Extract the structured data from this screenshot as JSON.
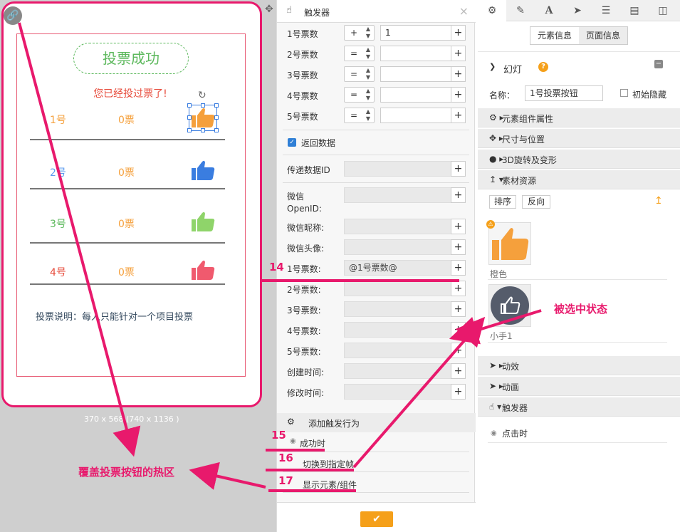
{
  "preview": {
    "vote_success": "投票成功",
    "already_voted": "您已经投过票了!",
    "rows": [
      {
        "label": "1号",
        "votes": "0票",
        "label_color": "#f5a03c",
        "thumb_color": "#f5a03c"
      },
      {
        "label": "2号",
        "votes": "0票",
        "label_color": "#5b9bef",
        "thumb_color": "#3a7de0"
      },
      {
        "label": "3号",
        "votes": "0票",
        "label_color": "#5cb85c",
        "thumb_color": "#8fd46a"
      },
      {
        "label": "4号",
        "votes": "0票",
        "label_color": "#e74c3c",
        "thumb_color": "#f05a6e"
      }
    ],
    "vote_note": "投票说明：每人只能针对一个项目投票",
    "canvas_size": "370 x 568 (740 x 1136 )"
  },
  "trigger_panel": {
    "title": "触发器",
    "vote_counts": [
      {
        "label": "1号票数",
        "op": "+",
        "value": "1"
      },
      {
        "label": "2号票数",
        "op": "=",
        "value": ""
      },
      {
        "label": "3号票数",
        "op": "=",
        "value": ""
      },
      {
        "label": "4号票数",
        "op": "=",
        "value": ""
      },
      {
        "label": "5号票数",
        "op": "=",
        "value": ""
      }
    ],
    "return_data": "返回数据",
    "pass_id": "传递数据ID",
    "wechat_openid": "微信\nOpenID:",
    "wechat_nickname": "微信昵称:",
    "wechat_avatar": "微信头像:",
    "data_fields": [
      {
        "label": "1号票数:",
        "value": "@1号票数@"
      },
      {
        "label": "2号票数:",
        "value": ""
      },
      {
        "label": "3号票数:",
        "value": ""
      },
      {
        "label": "4号票数:",
        "value": ""
      },
      {
        "label": "5号票数:",
        "value": ""
      },
      {
        "label": "创建时间:",
        "value": ""
      },
      {
        "label": "修改时间:",
        "value": ""
      }
    ],
    "add_trigger": "添加触发行为",
    "on_success": "成功时",
    "switch_frame": "切换到指定帧",
    "show_element": "显示元素/组件",
    "confirm": "✔"
  },
  "right_panel": {
    "tab_element_info": "元素信息",
    "tab_page_info": "页面信息",
    "slide": "幻灯",
    "name_label": "名称：",
    "name_value": "1号投票按钮",
    "initial_hidden": "初始隐藏",
    "sections": {
      "component_props": "元素组件属性",
      "size_position": "尺寸与位置",
      "rotate_3d": "3D旋转及变形",
      "assets": "素材资源",
      "effects": "动效",
      "animation": "动画",
      "trigger": "触发器"
    },
    "sort_btn": "排序",
    "reverse_btn": "反向",
    "asset1": "橙色",
    "asset2": "小手1",
    "click_time": "点击时",
    "accent": "#f5a01a"
  },
  "annotations": {
    "n14": "14",
    "n15": "15",
    "n16": "16",
    "n17": "17",
    "selected_state": "被选中状态",
    "hotspot": "覆盖投票按钮的热区",
    "color": "#e8196c"
  }
}
